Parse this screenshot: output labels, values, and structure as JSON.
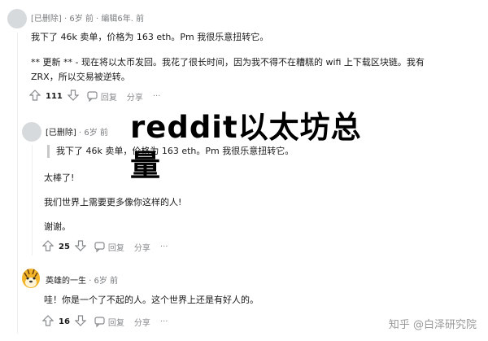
{
  "comments": [
    {
      "meta": "[已删除] · 6岁 前 · 编辑6年. 前",
      "lines": [
        "我下了 46k 卖单，价格为 163 eth。Pm 我很乐意扭转它。",
        "** 更新 ** - 现在将以太币发回。我花了很长时间，因为我不得不在糟糕的 wifi 上下载区块链。我有",
        "ZRX，所以交易被逆转。"
      ],
      "score": "111",
      "reply_label": "回复",
      "share_label": "分享",
      "more_label": "···"
    },
    {
      "user": "[已删除]",
      "time": "· 6岁 前",
      "quote": "我下了 46k 卖单，价格为 163 eth。Pm 我很乐意扭转它。",
      "lines": [
        "太棒了!",
        "我们世界上需要更多像你这样的人!",
        "谢谢。"
      ],
      "score": "25",
      "reply_label": "回复",
      "share_label": "分享",
      "more_label": "···"
    },
    {
      "user": "英雄的一生",
      "time": "· 6岁 前",
      "lines": [
        "哇！你是一个了不起的人。这个世界上还是有好人的。"
      ],
      "score": "16",
      "reply_label": "回复",
      "share_label": "分享",
      "more_label": "···"
    }
  ],
  "overlay": {
    "line1": "reddit以太坊总",
    "line2": "量"
  },
  "watermark": "知乎 @白泽研究院"
}
